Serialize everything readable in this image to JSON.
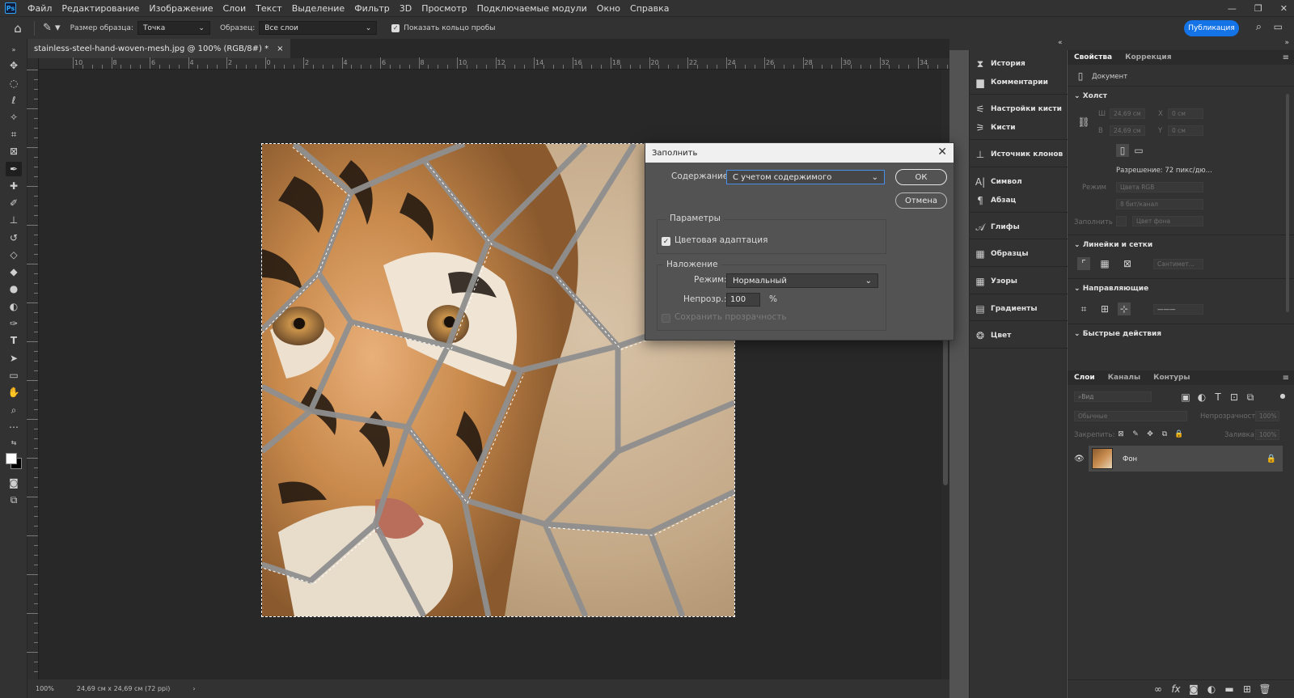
{
  "app": {
    "logo": "Ps",
    "menu": [
      "Файл",
      "Редактирование",
      "Изображение",
      "Слои",
      "Текст",
      "Выделение",
      "Фильтр",
      "3D",
      "Просмотр",
      "Подключаемые модули",
      "Окно",
      "Справка"
    ]
  },
  "options_bar": {
    "sample_size_label": "Размер образца:",
    "sample_size_value": "Точка",
    "sample_label": "Образец:",
    "sample_value": "Все слои",
    "show_ring_label": "Показать кольцо пробы",
    "publish_label": "Публикация"
  },
  "document": {
    "tab_title": "stainless-steel-hand-woven-mesh.jpg @ 100% (RGB/8#) *",
    "close_glyph": "×",
    "ruler_labels": [
      "10",
      "8",
      "6",
      "4",
      "2",
      "0",
      "2",
      "4",
      "6",
      "8",
      "10",
      "12",
      "14",
      "16",
      "18",
      "20",
      "22",
      "24",
      "26",
      "28",
      "30",
      "32",
      "34",
      "36"
    ],
    "status_zoom": "100%",
    "status_size": "24,69 см x 24,69 см (72 ppi)"
  },
  "fill_dialog": {
    "title": "Заполнить",
    "contents_label": "Содержание:",
    "contents_value": "С учетом содержимого",
    "ok_label": "ОК",
    "cancel_label": "Отмена",
    "options_group": "Параметры",
    "color_adaptation_label": "Цветовая адаптация",
    "blending_group": "Наложение",
    "mode_label": "Режим:",
    "mode_value": "Нормальный",
    "opacity_label": "Непрозр.:",
    "opacity_value": "100",
    "opacity_unit": "%",
    "preserve_transparency_label": "Сохранить прозрачность"
  },
  "mid_panel": {
    "items": [
      "История",
      "Комментарии",
      "Настройки кисти",
      "Кисти",
      "Источник клонов",
      "Символ",
      "Абзац",
      "Глифы",
      "Образцы",
      "Узоры",
      "Градиенты",
      "Цвет"
    ]
  },
  "properties_panel": {
    "tabs": [
      "Свойства",
      "Коррекция"
    ],
    "document_label": "Документ",
    "canvas_head": "Холст",
    "w_label": "Ш",
    "w_value": "24,69 см",
    "h_label": "В",
    "h_value": "24,69 см",
    "x_label": "X",
    "x_value": "0 см",
    "y_label": "Y",
    "y_value": "0 см",
    "resolution": "Разрешение: 72 пикс/дю...",
    "mode_label": "Режим",
    "mode_value": "Цвета RGB",
    "bit_value": "8 бит/канал",
    "fill_label": "Заполнить",
    "fill_value": "Цвет фона",
    "rulers_head": "Линейки и сетки",
    "rulers_unit": "Сантимет...",
    "guides_head": "Направляющие",
    "quick_head": "Быстрые действия"
  },
  "layers_panel": {
    "tabs": [
      "Слои",
      "Каналы",
      "Контуры"
    ],
    "search_placeholder": "Вид",
    "blend_mode": "Обычные",
    "opacity_label": "Непрозрачность:",
    "opacity_value": "100%",
    "lock_label": "Закрепить:",
    "fill_label": "Заливка:",
    "fill_value": "100%",
    "layer_name": "Фон"
  }
}
